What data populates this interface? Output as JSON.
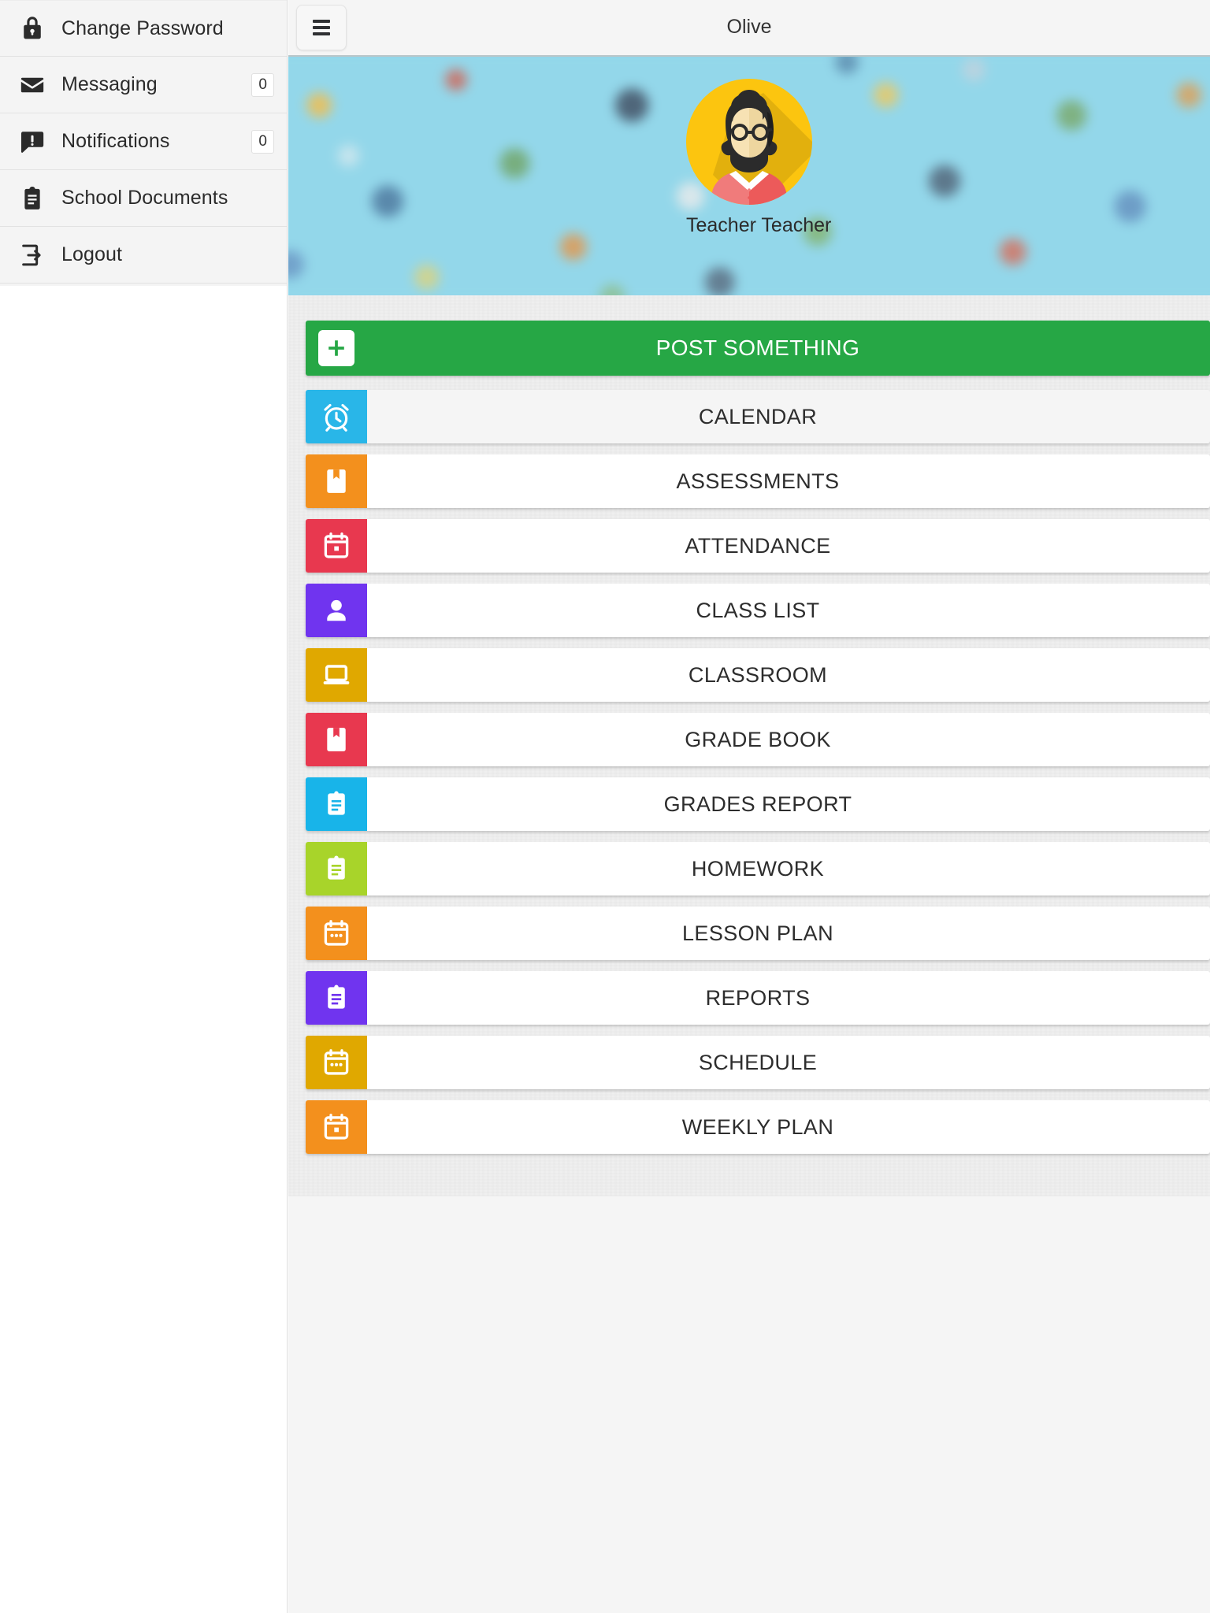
{
  "app": {
    "title": "Olive",
    "menu_toggle_icon": "hamburger-icon"
  },
  "sidebar": {
    "items": [
      {
        "label": "Change Password",
        "icon": "lock-icon",
        "badge": null
      },
      {
        "label": "Messaging",
        "icon": "envelope-icon",
        "badge": "0"
      },
      {
        "label": "Notifications",
        "icon": "alert-chat-icon",
        "badge": "0"
      },
      {
        "label": "School Documents",
        "icon": "clipboard-icon",
        "badge": null
      },
      {
        "label": "Logout",
        "icon": "logout-icon",
        "badge": null
      }
    ]
  },
  "profile": {
    "name": "Teacher Teacher",
    "avatar": "teacher-avatar",
    "cover": "school-illustration-banner"
  },
  "post_button": {
    "label": "POST SOMETHING",
    "icon": "plus-icon",
    "color": "#26a745"
  },
  "tiles": [
    {
      "label": "CALENDAR",
      "icon": "alarm-clock-icon",
      "color": "#29b6e8"
    },
    {
      "label": "ASSESSMENTS",
      "icon": "bookmark-book-icon",
      "color": "#f3901d"
    },
    {
      "label": "ATTENDANCE",
      "icon": "calendar-box-icon",
      "color": "#e8384f"
    },
    {
      "label": "CLASS LIST",
      "icon": "person-icon",
      "color": "#7034ef"
    },
    {
      "label": "CLASSROOM",
      "icon": "laptop-icon",
      "color": "#e0a800"
    },
    {
      "label": "GRADE BOOK",
      "icon": "bookmark-book-icon",
      "color": "#e8384f"
    },
    {
      "label": "GRADES REPORT",
      "icon": "clipboard-icon",
      "color": "#18b4e9"
    },
    {
      "label": "HOMEWORK",
      "icon": "clipboard-icon",
      "color": "#a8d42a"
    },
    {
      "label": "LESSON PLAN",
      "icon": "calendar-dots-icon",
      "color": "#f3901d"
    },
    {
      "label": "REPORTS",
      "icon": "clipboard-icon",
      "color": "#7034ef"
    },
    {
      "label": "SCHEDULE",
      "icon": "calendar-dots-icon",
      "color": "#e0a800"
    },
    {
      "label": "WEEKLY PLAN",
      "icon": "calendar-box-icon",
      "color": "#f3901d"
    }
  ]
}
